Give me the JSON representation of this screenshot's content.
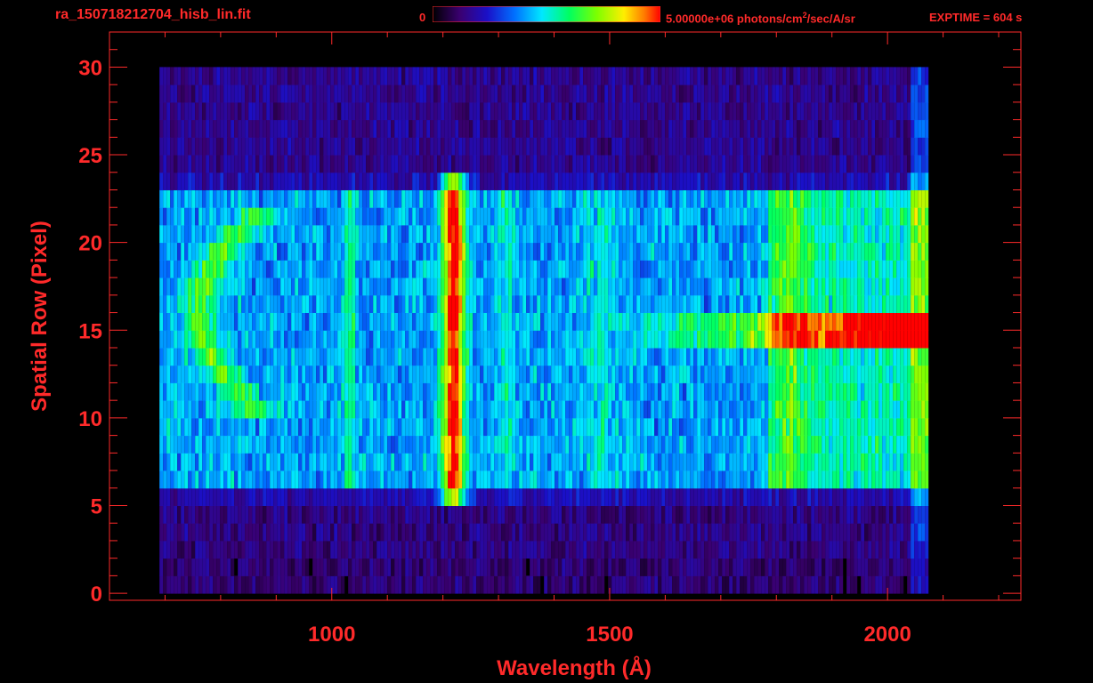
{
  "header": {
    "filename": "ra_150718212704_hisb_lin.fit",
    "colorbar_min": "0",
    "colorbar_max": "5.00000e+06",
    "units_prefix": " photons/cm",
    "units_exp": "2",
    "units_suffix": "/sec/A/sr",
    "exptime": "EXPTIME = 604 s"
  },
  "colors": {
    "axis": "#ff2a2a",
    "background": "#000000"
  },
  "chart_data": {
    "type": "heatmap",
    "title": "",
    "xlabel": "Wavelength (Å)",
    "ylabel": "Spatial Row (Pixel)",
    "xlim": [
      600,
      2240
    ],
    "ylim": [
      -0.4,
      32
    ],
    "xticks": [
      1000,
      1500,
      2000
    ],
    "yticks": [
      0,
      5,
      10,
      15,
      20,
      25,
      30
    ],
    "color_scale": {
      "min": 0,
      "max": 5000000,
      "colormap": "rainbow"
    },
    "data_extent": {
      "x": [
        690,
        2070
      ],
      "rows": [
        0,
        30
      ]
    },
    "features": [
      {
        "label": "band at Ly-alpha",
        "x_center": 1216,
        "rows": [
          5,
          24
        ],
        "peak_level": 0.95
      },
      {
        "label": "bright spectral row",
        "x": [
          1560,
          2070
        ],
        "rows": [
          14,
          16
        ],
        "peak_level": 0.85
      },
      {
        "label": "far-UV arc",
        "x": [
          780,
          840
        ],
        "rows": [
          11,
          21
        ],
        "peak_level": 0.5
      }
    ]
  }
}
